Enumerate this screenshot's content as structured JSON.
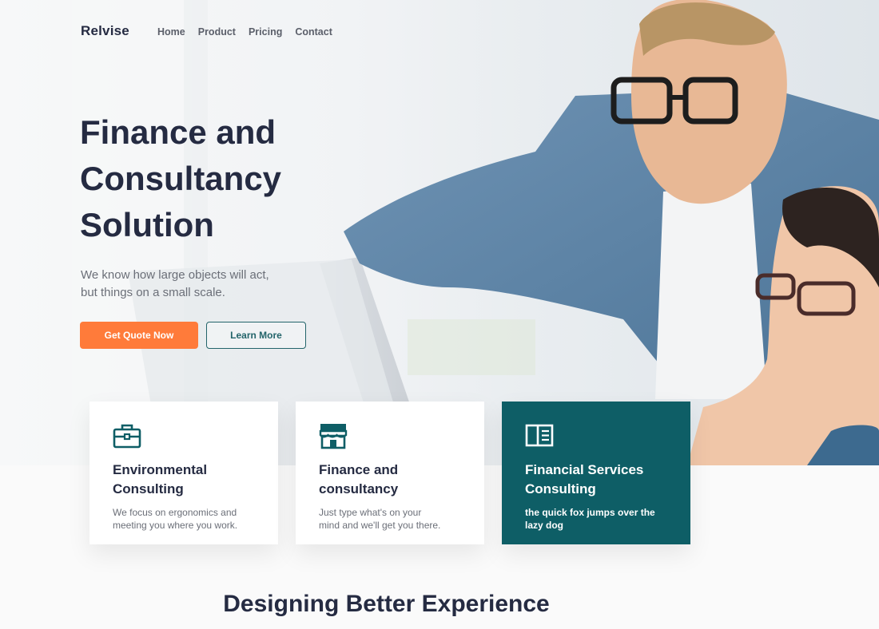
{
  "brand": {
    "logo_text": "Relvise"
  },
  "nav": {
    "items": [
      "Home",
      "Product",
      "Pricing",
      "Contact"
    ]
  },
  "hero": {
    "title_lines": [
      "Finance and",
      "Consultancy",
      "Solution"
    ],
    "subtitle_lines": [
      "We know how large objects will act,",
      "but things on a small scale."
    ],
    "primary_button": "Get Quote Now",
    "secondary_button": "Learn More"
  },
  "cards": [
    {
      "icon": "briefcase-icon",
      "title_lines": [
        "Environmental",
        "Consulting"
      ],
      "text_lines": [
        "We focus on ergonomics and",
        "meeting you where you work."
      ]
    },
    {
      "icon": "storefront-icon",
      "title_lines": [
        "Finance and",
        "consultancy"
      ],
      "text_lines": [
        "Just type what's on your",
        "mind and we'll get you there."
      ]
    },
    {
      "icon": "book-icon",
      "title_lines": [
        "Financial Services",
        "Consulting"
      ],
      "text_lines": [
        "the quick fox jumps over the",
        "lazy dog"
      ]
    }
  ],
  "section": {
    "title": "Designing Better Experience"
  },
  "colors": {
    "primary_orange": "#ff7b3a",
    "teal": "#0e5e66",
    "outline_teal": "#23646a",
    "heading": "#252b42",
    "body_text": "#6b6f78"
  }
}
